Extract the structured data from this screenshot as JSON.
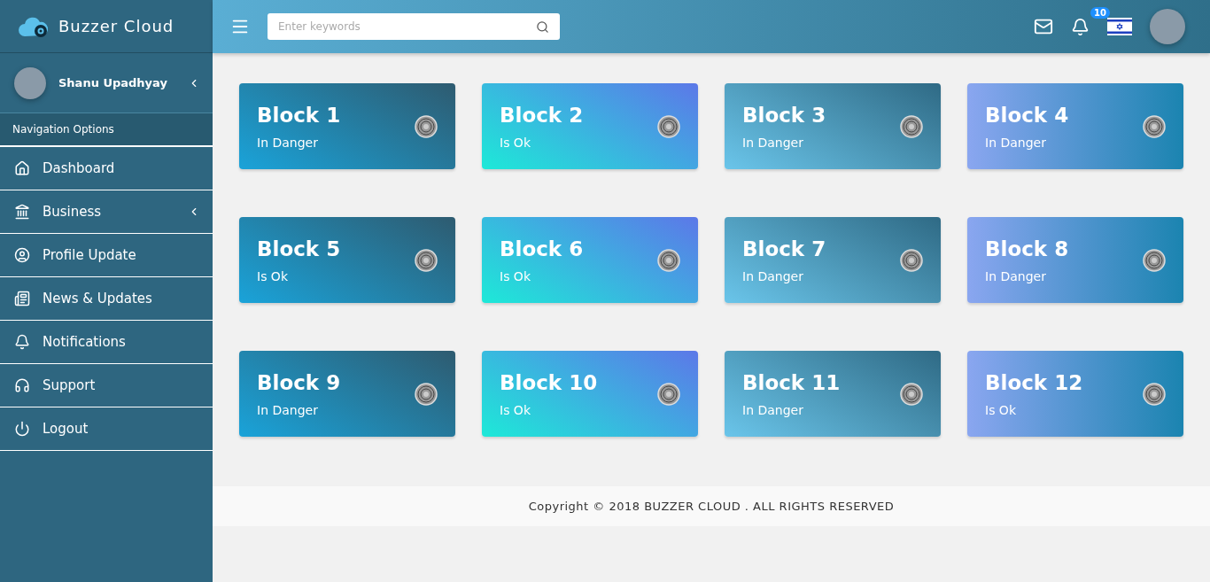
{
  "brand": {
    "name": "Buzzer Cloud"
  },
  "user": {
    "name": "Shanu Upadhyay"
  },
  "sidebar": {
    "heading": "Navigation Options",
    "items": [
      {
        "label": "Dashboard",
        "has_submenu": false
      },
      {
        "label": "Business",
        "has_submenu": true
      },
      {
        "label": "Profile Update",
        "has_submenu": false
      },
      {
        "label": "News & Updates",
        "has_submenu": false
      },
      {
        "label": "Notifications",
        "has_submenu": false
      },
      {
        "label": "Support",
        "has_submenu": false
      },
      {
        "label": "Logout",
        "has_submenu": false
      }
    ]
  },
  "topbar": {
    "search": {
      "placeholder": "Enter keywords"
    },
    "notifications_badge": "10"
  },
  "blocks": [
    {
      "title": "Block 1",
      "status": "In Danger"
    },
    {
      "title": "Block 2",
      "status": "Is Ok"
    },
    {
      "title": "Block 3",
      "status": "In Danger"
    },
    {
      "title": "Block 4",
      "status": "In Danger"
    },
    {
      "title": "Block 5",
      "status": "Is Ok"
    },
    {
      "title": "Block 6",
      "status": "Is Ok"
    },
    {
      "title": "Block 7",
      "status": "In Danger"
    },
    {
      "title": "Block 8",
      "status": "In Danger"
    },
    {
      "title": "Block 9",
      "status": "In Danger"
    },
    {
      "title": "Block 10",
      "status": "Is Ok"
    },
    {
      "title": "Block 11",
      "status": "In Danger"
    },
    {
      "title": "Block 12",
      "status": "Is Ok"
    }
  ],
  "footer": {
    "text": "Copyright © 2018 BUZZER CLOUD . ALL RIGHTS RESERVED"
  }
}
